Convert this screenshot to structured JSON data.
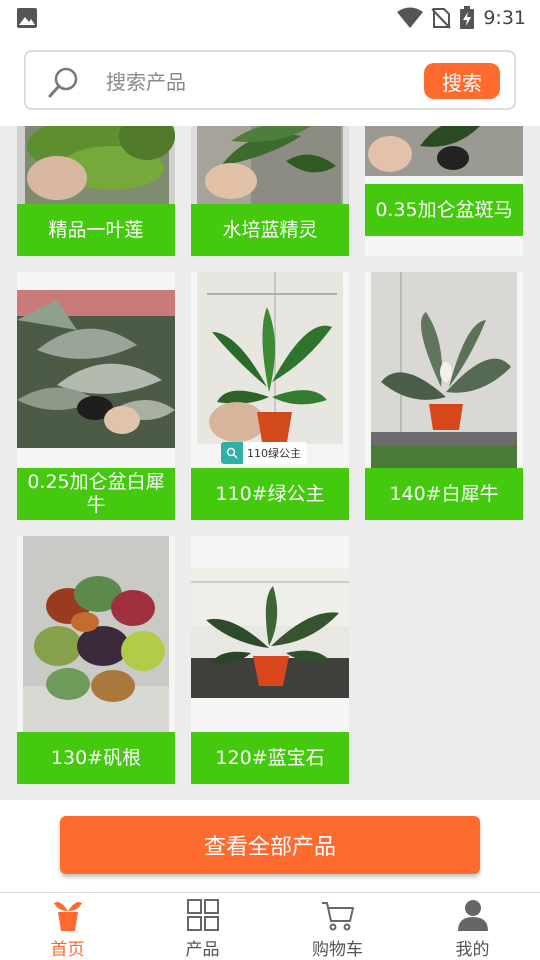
{
  "status_bar": {
    "time": "9:31"
  },
  "search": {
    "placeholder": "搜索产品",
    "button_label": "搜索"
  },
  "products": [
    {
      "name": "精品一叶莲"
    },
    {
      "name": "水培蓝精灵"
    },
    {
      "name": "0.35加仑盆斑马"
    },
    {
      "name": "0.25加仑盆白犀牛"
    },
    {
      "name": "110#绿公主",
      "tag": "110绿公主"
    },
    {
      "name": "140#白犀牛"
    },
    {
      "name": "130#矾根"
    },
    {
      "name": "120#蓝宝石"
    }
  ],
  "view_all_label": "查看全部产品",
  "nav": {
    "items": [
      {
        "label": "首页",
        "icon": "home-plant-icon",
        "active": true
      },
      {
        "label": "产品",
        "icon": "grid-icon",
        "active": false
      },
      {
        "label": "购物车",
        "icon": "cart-icon",
        "active": false
      },
      {
        "label": "我的",
        "icon": "person-icon",
        "active": false
      }
    ]
  },
  "colors": {
    "accent": "#ff6a2e",
    "label_green": "#44c90e"
  }
}
